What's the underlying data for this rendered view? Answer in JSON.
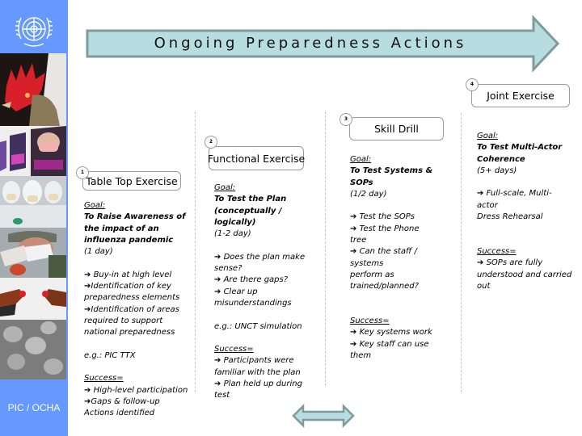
{
  "banner": {
    "title": "Ongoing Preparedness Actions",
    "fill": "#b7dde0",
    "stroke": "#7f9a9c"
  },
  "sidebar": {
    "background": "#6699ff",
    "logo_icon": "un-emblem-icon",
    "photos": [
      "rooster-photo",
      "mask-posters-photo",
      "protective-suits-photo",
      "masked-worker-photo",
      "roosters-photo",
      "virus-micrograph-photo"
    ],
    "footer": "PIC / OCHA"
  },
  "stages": [
    {
      "number": "1",
      "title": "Table Top Exercise",
      "goal_label": "Goal:",
      "goal_lines": [
        "To Raise Awareness of",
        "the impact of an",
        "influenza pandemic"
      ],
      "duration": "(1 day)",
      "outcomes": [
        {
          "arrow": true,
          "text": " Buy-in at high level"
        },
        {
          "arrow": true,
          "text": "Identification of key"
        },
        {
          "arrow": false,
          "text": "preparedness elements"
        },
        {
          "arrow": true,
          "text": "Identification of areas"
        },
        {
          "arrow": false,
          "text": "required to support"
        },
        {
          "arrow": false,
          "text": "national preparedness"
        }
      ],
      "example": "e.g.: PIC TTX",
      "success_label": "Success=",
      "success": [
        {
          "arrow": true,
          "text": " High-level participation"
        },
        {
          "arrow": true,
          "text": "Gaps & follow-up"
        },
        {
          "arrow": false,
          "text": "Actions identified"
        }
      ]
    },
    {
      "number": "2",
      "title": "Functional Exercise",
      "goal_label": "Goal:",
      "goal_lines": [
        "To Test the Plan",
        "(conceptually /",
        "logically)"
      ],
      "duration": "(1-2 day)",
      "outcomes": [
        {
          "arrow": true,
          "text": " Does the plan make"
        },
        {
          "arrow": false,
          "text": "sense?"
        },
        {
          "arrow": true,
          "text": " Are there gaps?"
        },
        {
          "arrow": true,
          "text": " Clear up"
        },
        {
          "arrow": false,
          "text": "misunderstandings"
        }
      ],
      "example": "e.g.: UNCT simulation",
      "success_label": "Success=",
      "success": [
        {
          "arrow": true,
          "text": " Participants were"
        },
        {
          "arrow": false,
          "text": "familiar with the plan"
        },
        {
          "arrow": true,
          "text": " Plan held up during"
        },
        {
          "arrow": false,
          "text": "test"
        }
      ]
    },
    {
      "number": "3",
      "title": "Skill Drill",
      "goal_label": "Goal:",
      "goal_lines": [
        "To Test Systems &",
        "SOPs"
      ],
      "duration": "(1/2 day)",
      "outcomes": [
        {
          "arrow": true,
          "text": " Test the SOPs"
        },
        {
          "arrow": true,
          "text": " Test the Phone"
        },
        {
          "arrow": false,
          "text": "tree"
        },
        {
          "arrow": true,
          "text": " Can the staff /"
        },
        {
          "arrow": false,
          "text": "systems"
        },
        {
          "arrow": false,
          "text": "perform as"
        },
        {
          "arrow": false,
          "text": "trained/planned?"
        }
      ],
      "success_label": "Success=",
      "success": [
        {
          "arrow": true,
          "text": " Key systems work"
        },
        {
          "arrow": true,
          "text": " Key staff can use"
        },
        {
          "arrow": false,
          "text": "them"
        }
      ]
    },
    {
      "number": "4",
      "title": "Joint Exercise",
      "goal_label": "Goal:",
      "goal_lines": [
        "To Test Multi-Actor",
        "Coherence"
      ],
      "duration": "(5+ days)",
      "outcomes": [
        {
          "arrow": true,
          "text": " Full-scale, Multi-"
        },
        {
          "arrow": false,
          "text": "actor"
        },
        {
          "arrow": false,
          "text": "Dress Rehearsal"
        }
      ],
      "success_label": "Success=",
      "success": [
        {
          "arrow": true,
          "text": " SOPs are fully"
        },
        {
          "arrow": false,
          "text": "understood and carried"
        },
        {
          "arrow": false,
          "text": "out"
        }
      ]
    }
  ],
  "footer_arrow": {
    "icon": "double-arrow-icon",
    "fill": "#b7dde0",
    "stroke": "#7f9a9c"
  }
}
